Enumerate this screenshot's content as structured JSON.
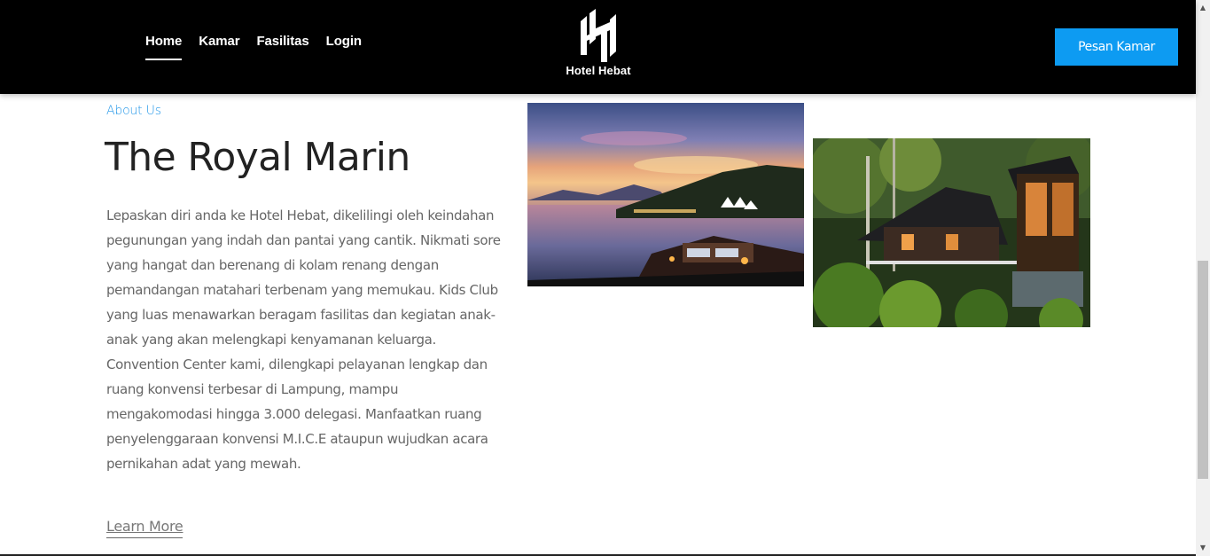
{
  "nav": {
    "items": [
      {
        "label": "Home"
      },
      {
        "label": "Kamar"
      },
      {
        "label": "Fasilitas"
      },
      {
        "label": "Login"
      }
    ]
  },
  "brand": {
    "name": "Hotel Hebat",
    "logo_icon": "hh-monogram-icon"
  },
  "header": {
    "cta_label": "Pesan Kamar"
  },
  "about": {
    "label": "About Us",
    "title": "The Royal Marin",
    "description": "Lepaskan diri anda ke Hotel Hebat, dikelilingi oleh keindahan pegunungan yang indah dan pantai yang cantik. Nikmati sore yang hangat dan berenang di kolam renang dengan pemandangan matahari terbenam yang memukau. Kids Club yang luas menawarkan beragam fasilitas dan kegiatan anak-anak yang akan melengkapi kenyamanan keluarga. Convention Center kami, dilengkapi pelayanan lengkap dan ruang konvensi terbesar di Lampung, mampu mengakomodasi hingga 3.000 delegasi. Manfaatkan ruang penyelenggaraan konvensi M.I.C.E ataupun wujudkan acara pernikahan adat yang mewah.",
    "link_label": "Learn More"
  },
  "images": [
    {
      "name": "sunset-lagoon-photo"
    },
    {
      "name": "jungle-villa-photo"
    }
  ],
  "colors": {
    "accent": "#0d9bf2",
    "header_bg": "#000000",
    "label_blue": "#2196e8"
  }
}
